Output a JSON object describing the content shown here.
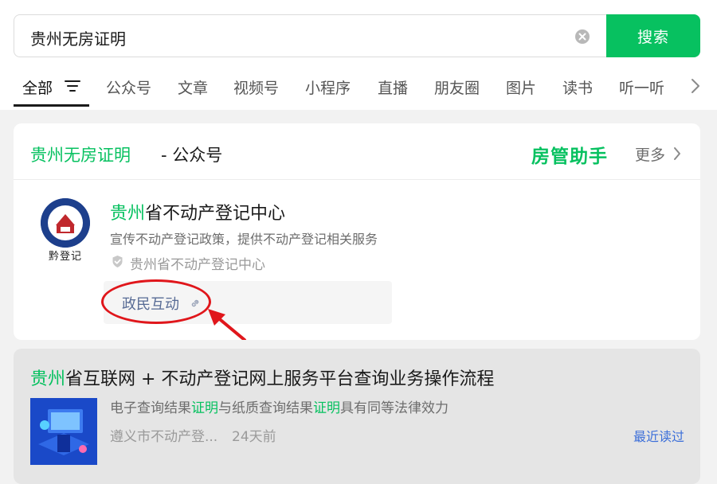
{
  "search": {
    "query": "贵州无房证明",
    "button_label": "搜索"
  },
  "tabs": [
    "全部",
    "公众号",
    "文章",
    "视频号",
    "小程序",
    "直播",
    "朋友圈",
    "图片",
    "读书",
    "听一听"
  ],
  "account_card": {
    "query_label": "贵州无房证明",
    "type_label": "- 公众号",
    "assistant": "房管助手",
    "more": "更多",
    "account": {
      "name_highlight": "贵州",
      "name_rest": "省不动产登记中心",
      "description": "宣传不动产登记政策，提供不动产登记相关服务",
      "verified_by": "贵州省不动产登记中心",
      "logo_caption": "黔登记",
      "menu_item": "政民互动"
    }
  },
  "article": {
    "title_highlight": "贵州",
    "title_rest": "省互联网 + 不动产登记网上服务平台查询业务操作流程",
    "desc_parts": [
      "电子查询结果",
      "证明",
      "与纸质查询结果",
      "证明",
      "具有同等法律效力"
    ],
    "source": "遵义市不动产登...",
    "time": "24天前",
    "badge": "最近读过"
  },
  "colors": {
    "brand_green": "#07c160",
    "link_blue": "#576b95",
    "annotation_red": "#e0161b"
  },
  "icons": [
    "clear-icon",
    "filter-icon",
    "chevron-right-icon",
    "verified-icon",
    "link-icon"
  ]
}
